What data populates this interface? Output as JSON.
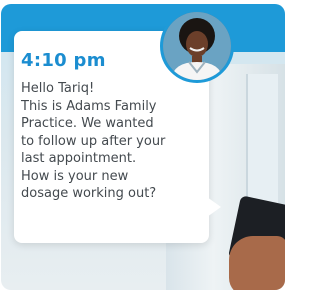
{
  "colors": {
    "brand_blue": "#1e9ad8",
    "time_blue": "#1b8dd0",
    "text_gray": "#444a4f"
  },
  "message": {
    "time": "4:10 pm",
    "lines": [
      "Hello Tariq!",
      "This is Adams Family",
      "Practice. We wanted",
      "to follow up after your",
      "last appointment.",
      "How is your new",
      "dosage working out?"
    ]
  },
  "icons": {
    "avatar": "doctor-avatar-photo",
    "phone": "smartphone-in-hand"
  }
}
